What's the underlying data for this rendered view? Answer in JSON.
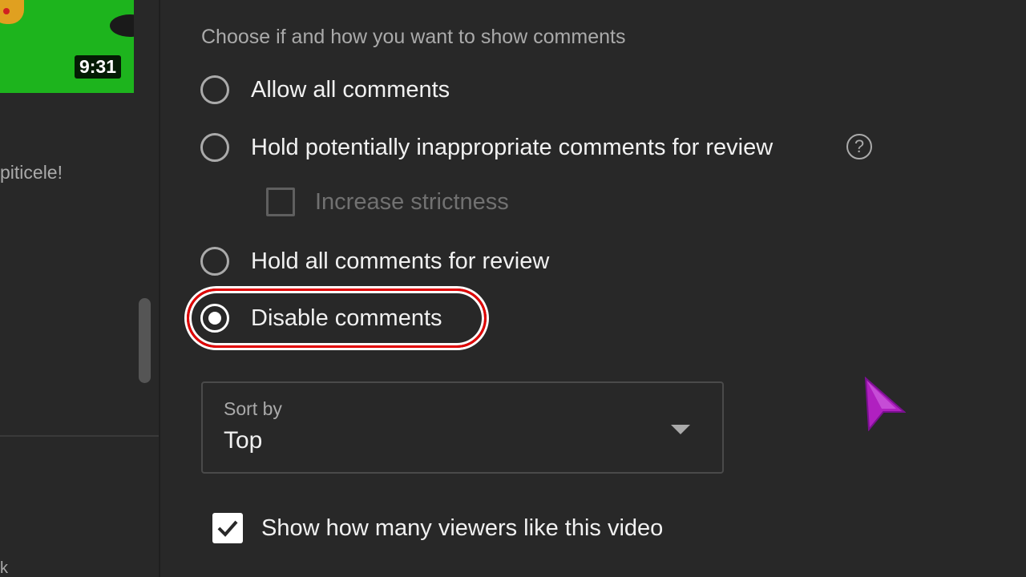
{
  "left_panel": {
    "duration": "9:31",
    "title_fragment": "piticele!",
    "bottom_fragment": "k"
  },
  "comments": {
    "subtitle": "Choose if and how you want to show comments",
    "options": [
      {
        "label": "Allow all comments",
        "selected": false
      },
      {
        "label": "Hold potentially inappropriate comments for review",
        "selected": false
      },
      {
        "label": "Hold all comments for review",
        "selected": false
      },
      {
        "label": "Disable comments",
        "selected": true
      }
    ],
    "help_icon": "?",
    "increase_strictness": {
      "label": "Increase strictness",
      "checked": false,
      "disabled": true
    }
  },
  "sort": {
    "label": "Sort by",
    "value": "Top"
  },
  "likes": {
    "label": "Show how many viewers like this video",
    "checked": true
  },
  "colors": {
    "background": "#282828",
    "highlight": "#e00000",
    "cursor": "#b020c0"
  }
}
